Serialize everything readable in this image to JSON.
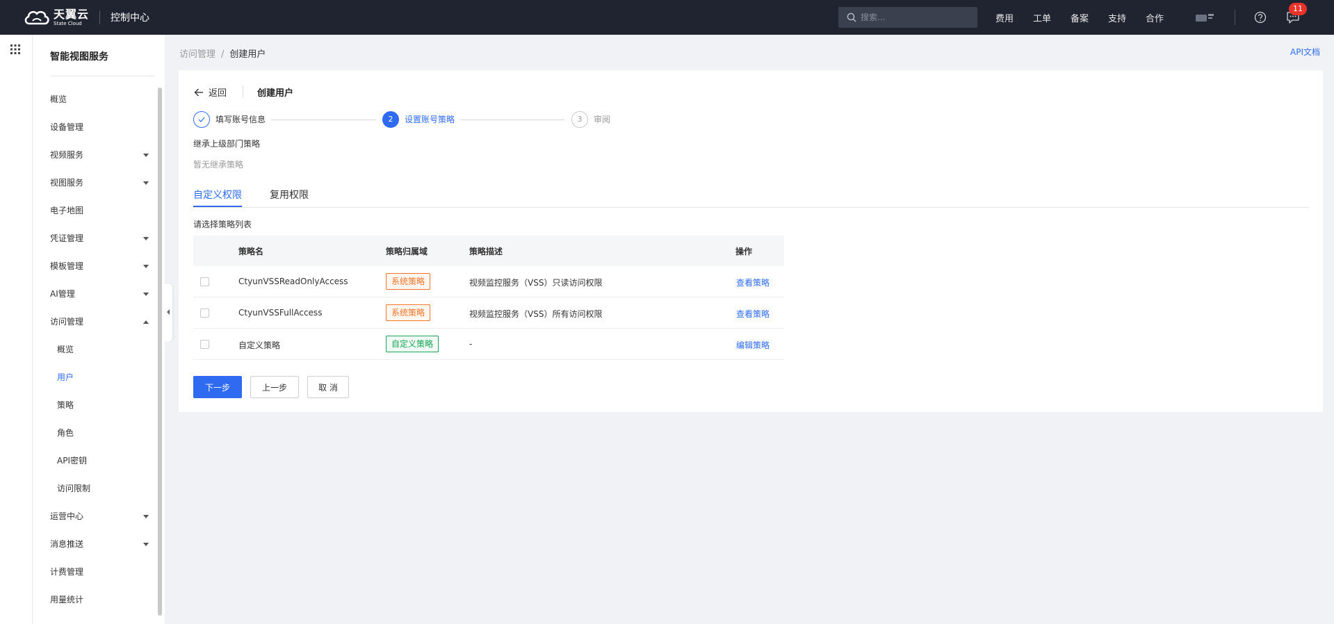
{
  "topbar": {
    "logo_cn": "天翼云",
    "logo_en": "State Cloud",
    "console": "控制中心",
    "search_placeholder": "搜索...",
    "nav": [
      "费用",
      "工单",
      "备案",
      "支持",
      "合作"
    ],
    "badge_count": "11"
  },
  "sidebar": {
    "title": "智能视图服务",
    "items": [
      {
        "label": "概览",
        "expandable": false
      },
      {
        "label": "设备管理",
        "expandable": false
      },
      {
        "label": "视频服务",
        "expandable": true
      },
      {
        "label": "视图服务",
        "expandable": true
      },
      {
        "label": "电子地图",
        "expandable": false
      },
      {
        "label": "凭证管理",
        "expandable": true
      },
      {
        "label": "模板管理",
        "expandable": true
      },
      {
        "label": "AI管理",
        "expandable": true
      },
      {
        "label": "访问管理",
        "expandable": true,
        "expanded": true
      },
      {
        "label": "概览",
        "sub": true
      },
      {
        "label": "用户",
        "sub": true,
        "active": true
      },
      {
        "label": "策略",
        "sub": true
      },
      {
        "label": "角色",
        "sub": true
      },
      {
        "label": "API密钥",
        "sub": true
      },
      {
        "label": "访问限制",
        "sub": true
      },
      {
        "label": "运营中心",
        "expandable": true
      },
      {
        "label": "消息推送",
        "expandable": true
      },
      {
        "label": "计费管理",
        "expandable": false
      },
      {
        "label": "用量统计",
        "expandable": false
      }
    ]
  },
  "breadcrumb": {
    "parent": "访问管理",
    "sep": "/",
    "current": "创建用户"
  },
  "api_doc": "API文档",
  "header": {
    "back": "返回",
    "title": "创建用户"
  },
  "steps": [
    {
      "label": "填写账号信息",
      "status": "done"
    },
    {
      "num": "2",
      "label": "设置账号策略",
      "status": "active"
    },
    {
      "num": "3",
      "label": "审阅",
      "status": "wait"
    }
  ],
  "inherit": {
    "title": "继承上级部门策略",
    "empty": "暂无继承策略"
  },
  "tabs": [
    {
      "label": "自定义权限",
      "active": true
    },
    {
      "label": "复用权限",
      "active": false
    }
  ],
  "list_title": "请选择策略列表",
  "table": {
    "headers": [
      "策略名",
      "策略归属域",
      "策略描述",
      "操作"
    ],
    "rows": [
      {
        "name": "CtyunVSSReadOnlyAccess",
        "domain": "系统策略",
        "domain_type": "sys",
        "desc": "视频监控服务（VSS）只读访问权限",
        "op": "查看策略"
      },
      {
        "name": "CtyunVSSFullAccess",
        "domain": "系统策略",
        "domain_type": "sys",
        "desc": "视频监控服务（VSS）所有访问权限",
        "op": "查看策略"
      },
      {
        "name": "自定义策略",
        "domain": "自定义策略",
        "domain_type": "custom",
        "desc": "-",
        "op": "编辑策略"
      }
    ]
  },
  "buttons": {
    "next": "下一步",
    "prev": "上一步",
    "cancel": "取 消"
  },
  "colors": {
    "accent": "#2f6bf1",
    "topbar": "#1f2430",
    "sys_tag": "#f5742b",
    "custom_tag": "#1aa35a",
    "badge": "#e8332a"
  }
}
